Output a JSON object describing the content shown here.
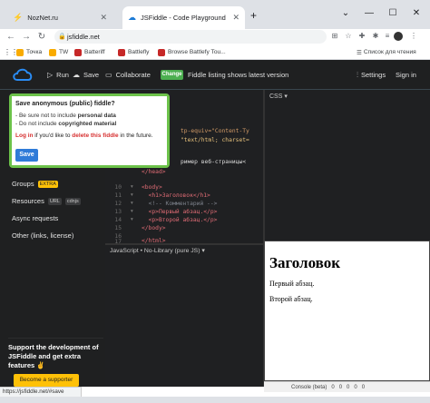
{
  "browser": {
    "tabs": [
      {
        "title": "NozNet.ru",
        "close": "✕"
      },
      {
        "title": "JSFiddle - Code Playground",
        "close": "✕"
      }
    ],
    "new_tab": "+",
    "window_controls": {
      "collapse": "⌄",
      "minimize": "—",
      "maximize": "☐",
      "close": "✕"
    },
    "url": "jsfiddle.net",
    "bookmarks": [
      "Точка",
      "TW",
      "Batteriff",
      "Battlefly",
      "Browse Battlefy Tou..."
    ],
    "reading_list": "Список для чтения",
    "status_url": "https://jsfiddle.net/#save"
  },
  "header": {
    "run": "Run",
    "save": "Save",
    "collaborate": "Collaborate",
    "change_badge": "Change",
    "listing_text": "Fiddle listing shows latest version",
    "settings": "Settings",
    "sign_in": "Sign in"
  },
  "sidebar": {
    "groups": "Groups",
    "groups_tag": "EXTRA",
    "resources": "Resources",
    "resources_tags": [
      "URL",
      "cdnjs"
    ],
    "async": "Async requests",
    "other": "Other (links, license)",
    "support_text": "Support the development of JSFiddle and get extra features",
    "support_emoji": "✌",
    "supporter_button": "Become a supporter"
  },
  "popup": {
    "title": "Save anonymous (public) fiddle?",
    "line1_prefix": "- Be sure not to include ",
    "line1_bold": "personal data",
    "line2_prefix": "- Do not include ",
    "line2_bold": "copyrighted material",
    "login_link": "Log in",
    "login_mid": " if you'd like to ",
    "login_delete": "delete this fiddle",
    "login_end": " in the future.",
    "save_button": "Save"
  },
  "html_editor": {
    "code_lines": [
      {
        "n": "",
        "text": "tp-equiv=\"Content-Ty"
      },
      {
        "n": "",
        "text": "\"text/html; charset="
      },
      {
        "n": "",
        "text": ""
      },
      {
        "n": "",
        "text": "ример веб-страницы<"
      },
      {
        "n": "",
        "text": "</head>"
      },
      {
        "n": "",
        "text": ""
      },
      {
        "n": "10",
        "text": "<body>"
      },
      {
        "n": "11",
        "text": "  <h1>Заголовок</h1>"
      },
      {
        "n": "12",
        "text": "  <!-- Комментарий -->"
      },
      {
        "n": "13",
        "text": "  <p>Первый абзац.</p>"
      },
      {
        "n": "14",
        "text": "  <p>Второй абзац.</p>"
      },
      {
        "n": "15",
        "text": "</body>"
      },
      {
        "n": "16",
        "text": ""
      },
      {
        "n": "17",
        "text": "</html>"
      }
    ]
  },
  "css_editor": {
    "label": "CSS"
  },
  "js_editor": {
    "label": "JavaScript • No-Library (pure JS)"
  },
  "result": {
    "h1": "Заголовок",
    "p1": "Первый абзац.",
    "p2": "Второй абзац."
  },
  "console": {
    "label": "Console (beta)",
    "counts": [
      "0",
      "0",
      "0",
      "0",
      "0"
    ]
  }
}
